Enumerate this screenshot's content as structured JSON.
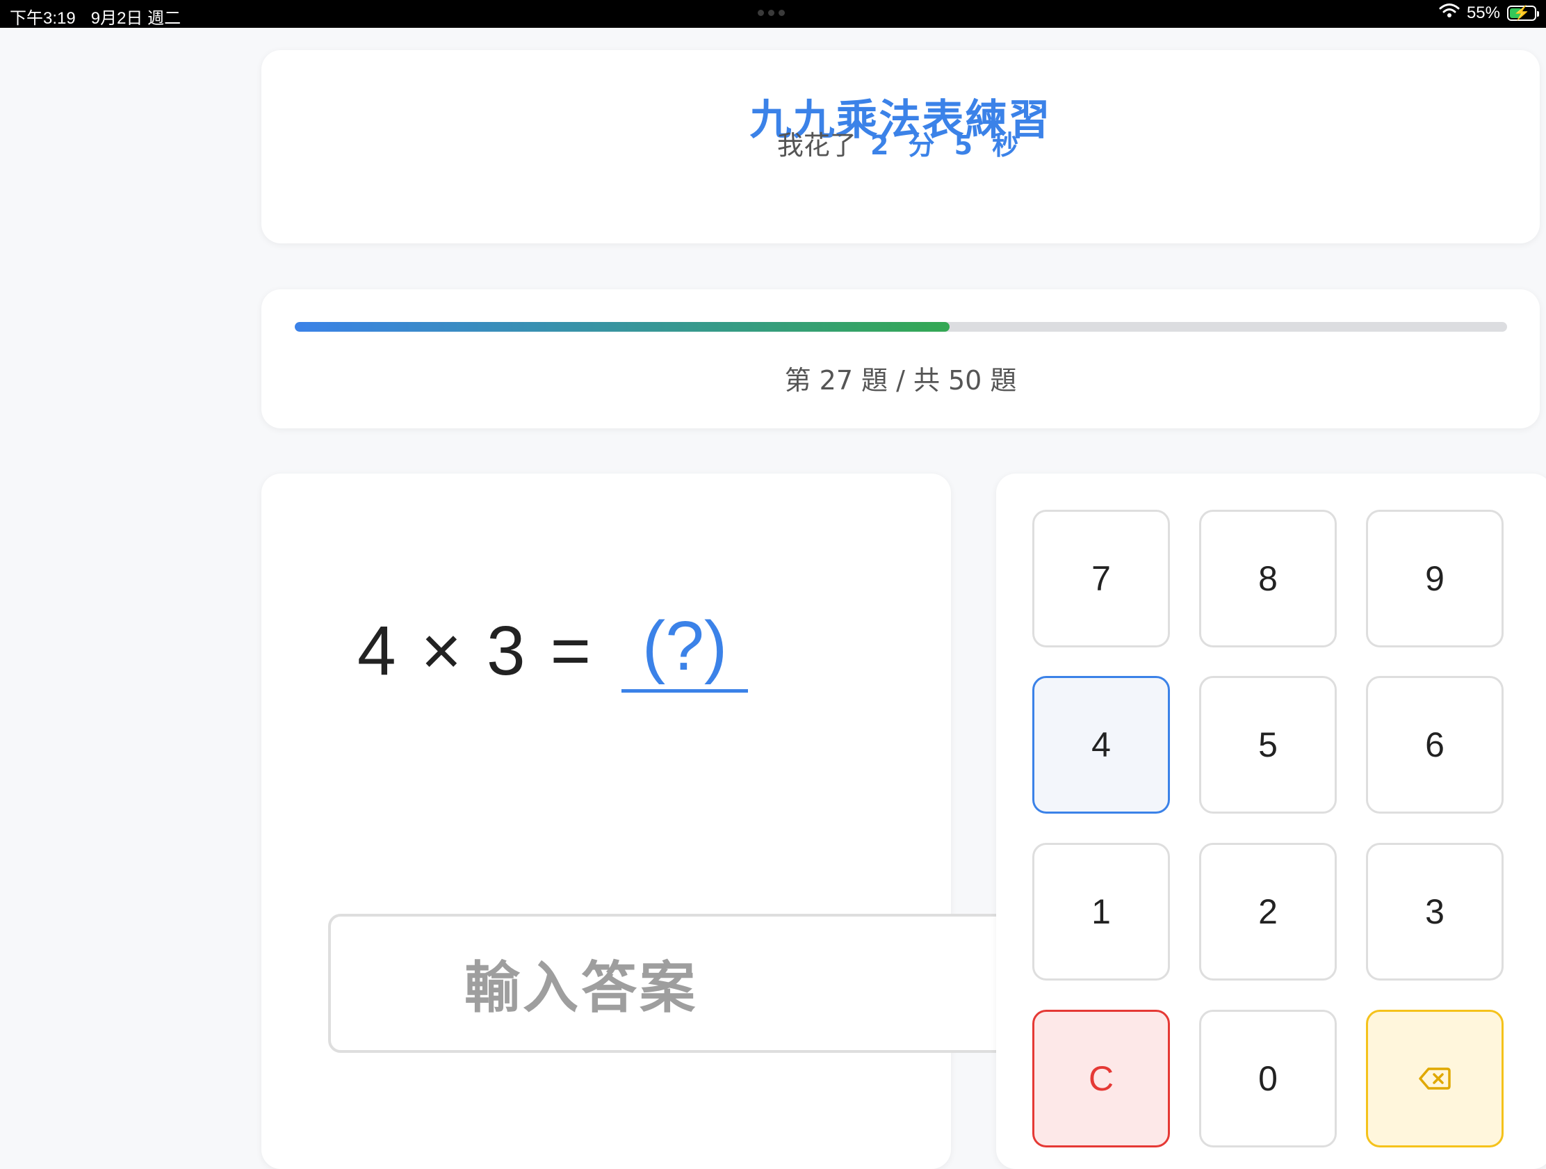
{
  "status_bar": {
    "time": "下午3:19",
    "date": "9月2日 週二",
    "battery": "55%",
    "battery_level": 0.55
  },
  "header": {
    "title": "九九乘法表練習",
    "timer_prefix": "我花了",
    "minutes": "2",
    "minutes_unit": "分",
    "seconds": "5",
    "seconds_unit": "秒"
  },
  "progress": {
    "label_prefix": "第",
    "current": "27",
    "label_mid": "題 / 共",
    "total": "50",
    "label_suffix": "題",
    "fraction": 0.54
  },
  "question": {
    "operand_a": "4",
    "operator": "×",
    "operand_b": "3",
    "equals": "=",
    "answer_placeholder": "(?)",
    "input_placeholder": "輸入答案"
  },
  "keypad": {
    "keys": [
      "7",
      "8",
      "9",
      "4",
      "5",
      "6",
      "1",
      "2",
      "3",
      "C",
      "0",
      "⌫"
    ],
    "active_key": "4"
  },
  "colors": {
    "accent": "#3b82e8",
    "progress_end": "#34a853",
    "clear": "#e53935",
    "backspace": "#f5c21b"
  }
}
